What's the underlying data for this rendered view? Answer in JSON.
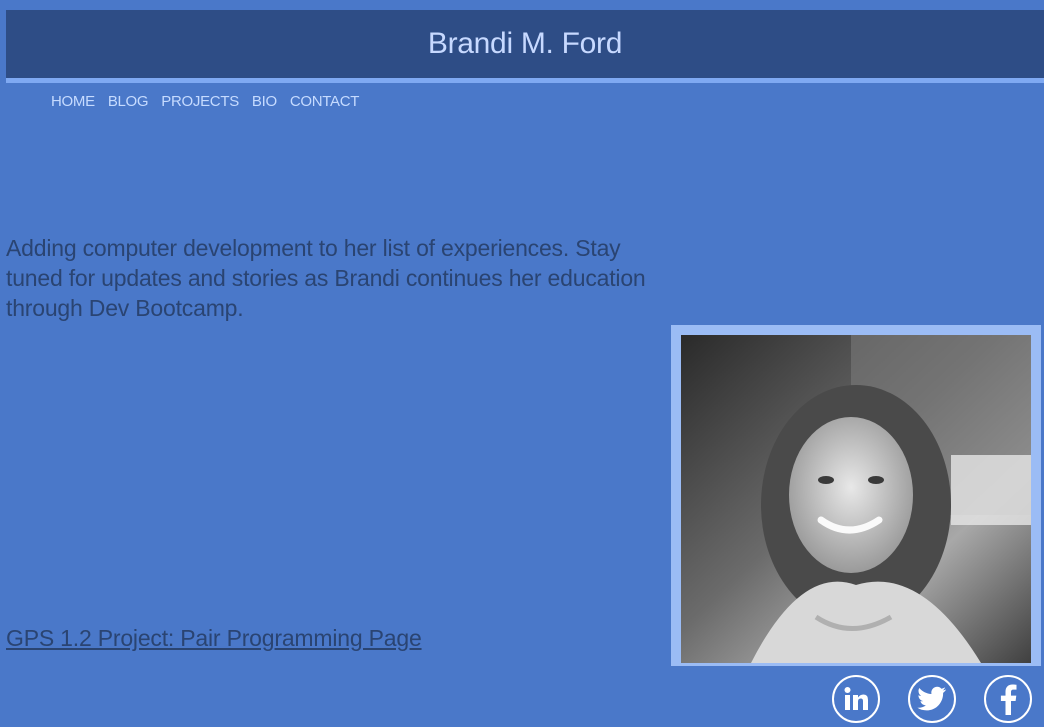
{
  "header": {
    "title": "Brandi M. Ford"
  },
  "nav": {
    "items": [
      {
        "label": "HOME"
      },
      {
        "label": "BLOG"
      },
      {
        "label": "PROJECTS"
      },
      {
        "label": "BIO"
      },
      {
        "label": "CONTACT"
      }
    ]
  },
  "main": {
    "intro": "Adding computer development to her list of experiences. Stay tuned for updates and stories as Brandi continues her education through Dev Bootcamp.",
    "project_link": "GPS 1.2 Project: Pair Programming Page",
    "photo": {
      "subject": "portrait-photo"
    }
  },
  "social": {
    "icons": [
      "linkedin-icon",
      "twitter-icon",
      "facebook-icon"
    ]
  },
  "colors": {
    "background": "#4a78c9",
    "header_bg": "#2e4d86",
    "header_border": "#7fa9f2",
    "title_text": "#c7d9ff",
    "body_text": "#2a4472",
    "photo_frame": "#9bbcf5"
  }
}
